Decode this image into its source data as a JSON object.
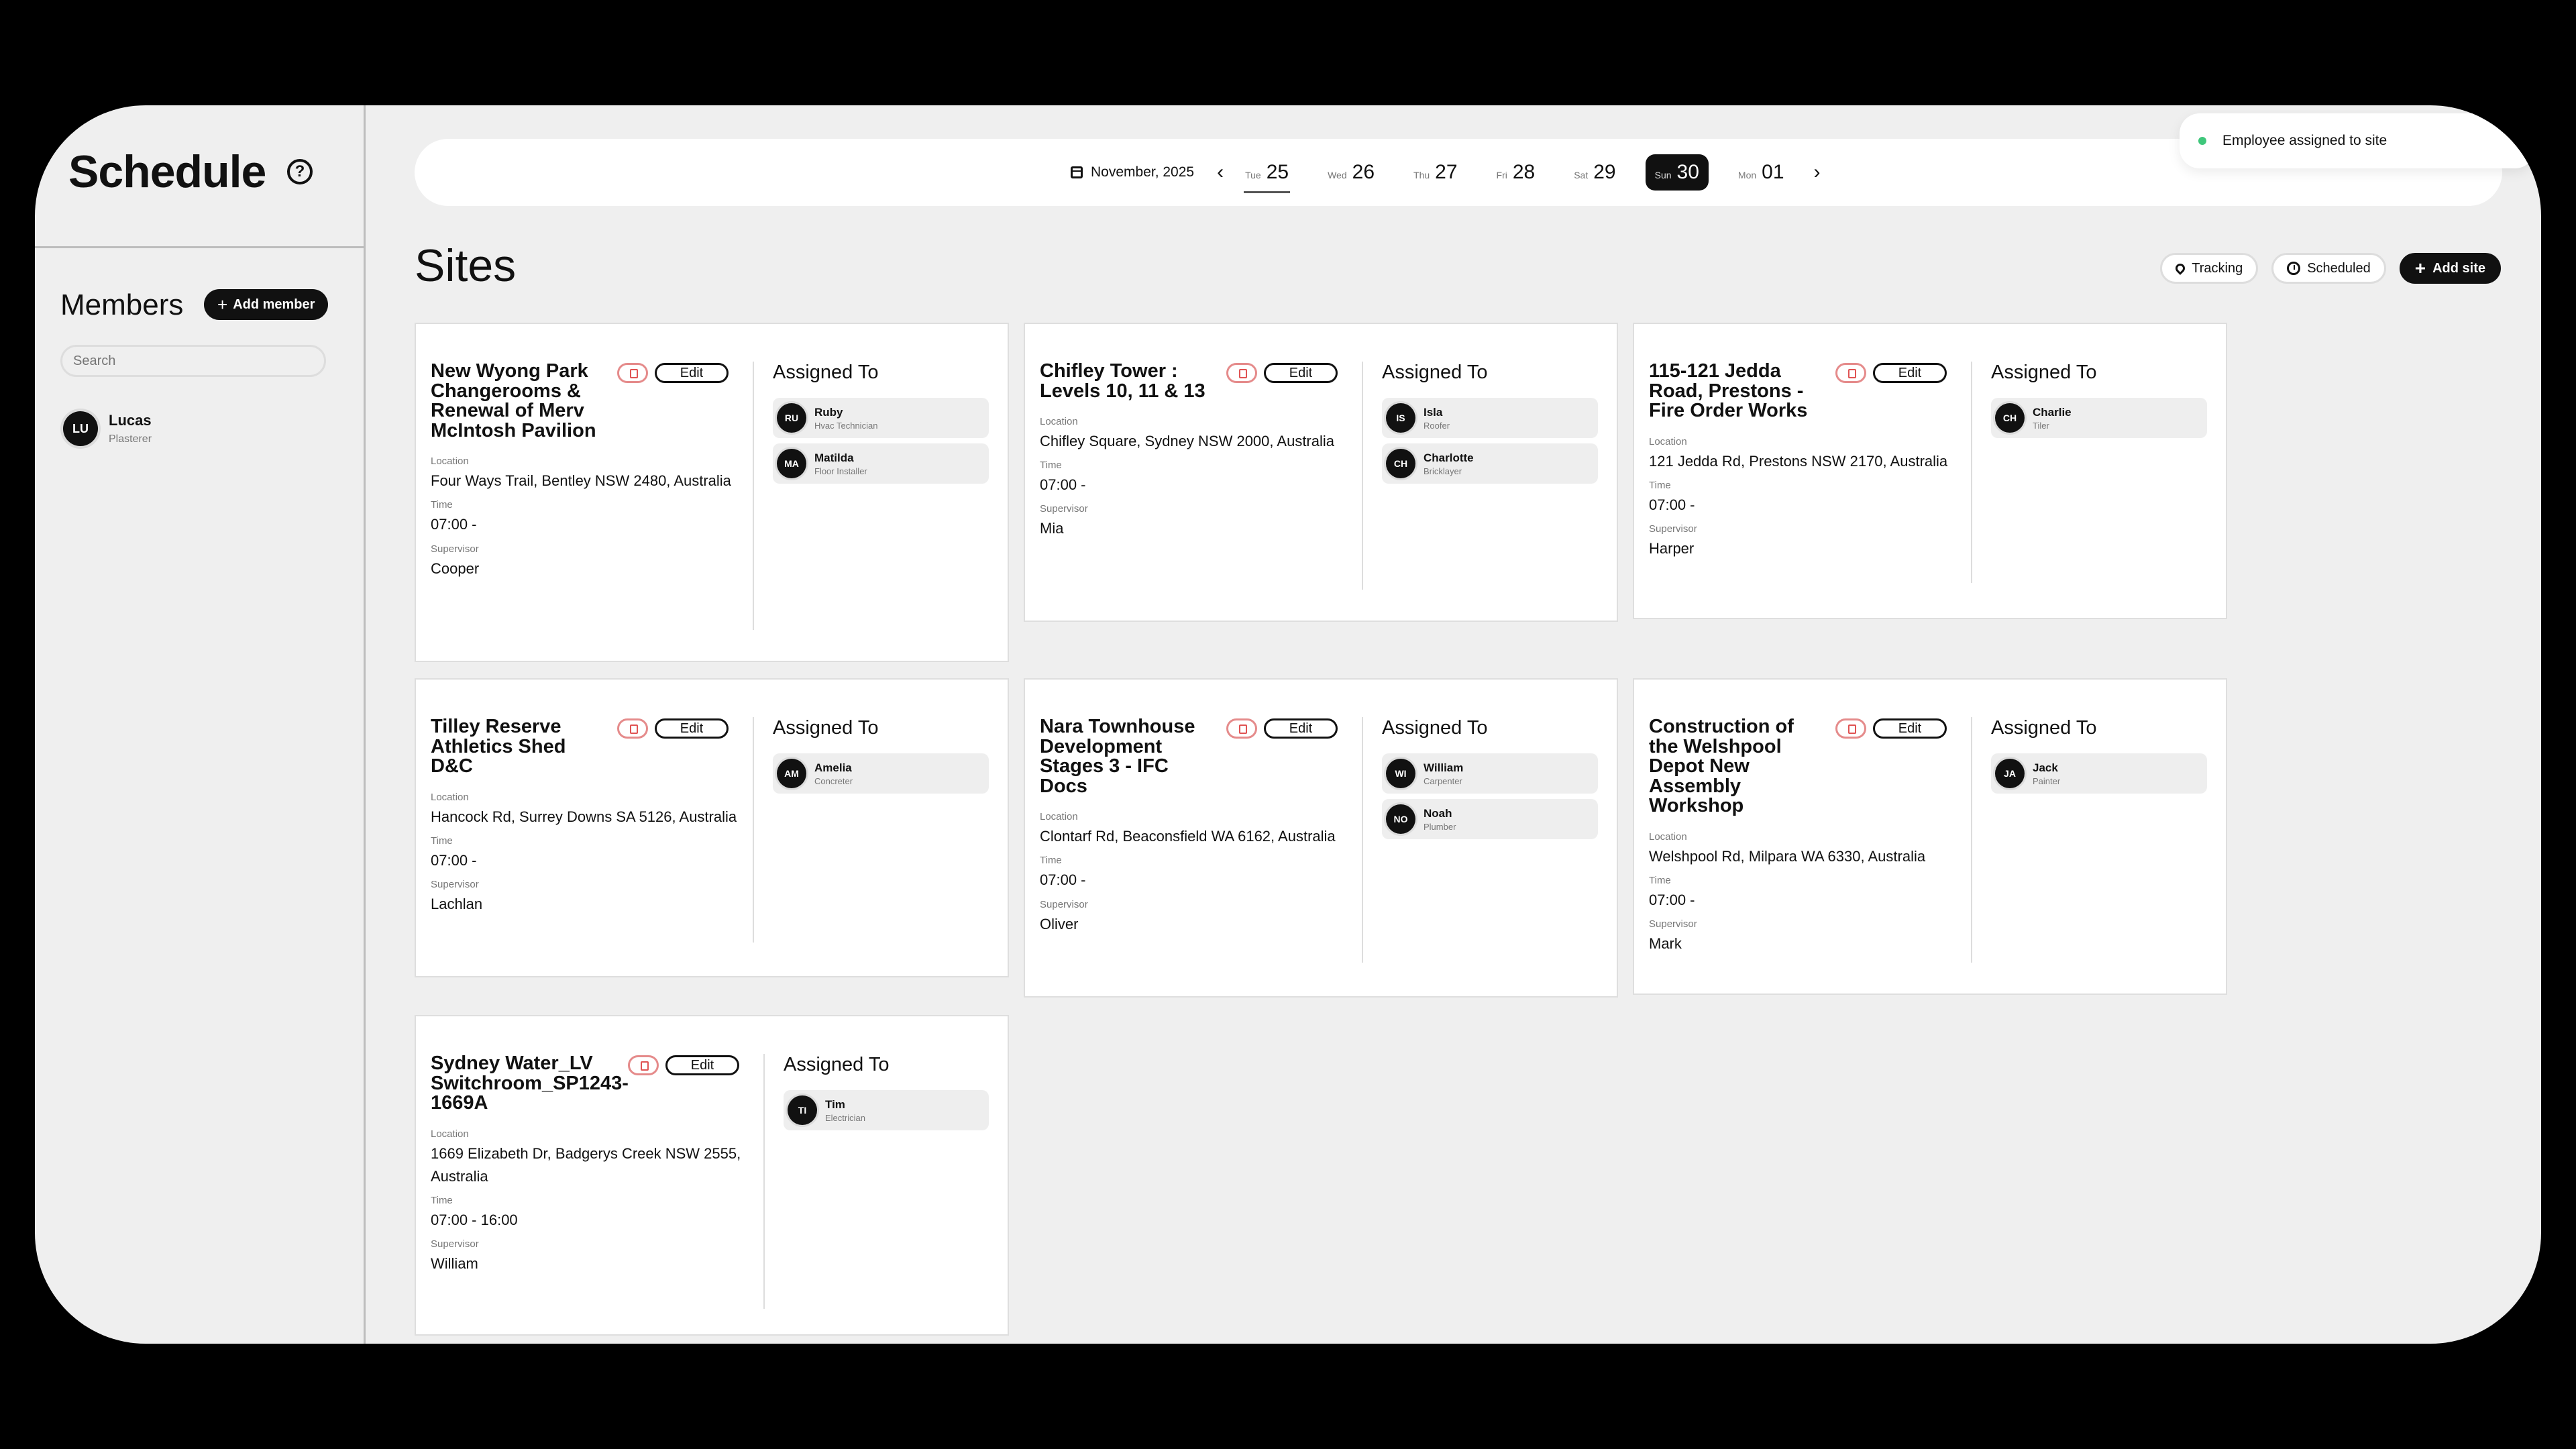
{
  "app": {
    "title": "Schedule"
  },
  "sidebar": {
    "members_title": "Members",
    "add_member_label": "Add member",
    "search_placeholder": "Search",
    "members": [
      {
        "initials": "LU",
        "name": "Lucas",
        "role": "Plasterer"
      }
    ]
  },
  "datebar": {
    "month": "November, 2025",
    "days": [
      {
        "dow": "Tue",
        "num": "25"
      },
      {
        "dow": "Wed",
        "num": "26"
      },
      {
        "dow": "Thu",
        "num": "27"
      },
      {
        "dow": "Fri",
        "num": "28"
      },
      {
        "dow": "Sat",
        "num": "29"
      },
      {
        "dow": "Sun",
        "num": "30"
      },
      {
        "dow": "Mon",
        "num": "01"
      }
    ]
  },
  "toast": {
    "message": "Employee assigned to site"
  },
  "main": {
    "title": "Sites",
    "toolbar": {
      "tracking": "Tracking",
      "scheduled": "Scheduled",
      "add_site": "Add site"
    },
    "labels": {
      "location": "Location",
      "time": "Time",
      "supervisor": "Supervisor",
      "assigned_to": "Assigned To",
      "edit": "Edit"
    },
    "sites": [
      {
        "name": "New Wyong Park Changerooms & Renewal of Merv McIntosh Pavilion",
        "location": "Four Ways Trail, Bentley NSW 2480, Australia",
        "time": "07:00 -",
        "supervisor": "Cooper",
        "assigned": [
          {
            "initials": "RU",
            "name": "Ruby",
            "role": "Hvac Technician"
          },
          {
            "initials": "MA",
            "name": "Matilda",
            "role": "Floor Installer"
          }
        ]
      },
      {
        "name": "Chifley Tower : Levels 10, 11 & 13",
        "location": "Chifley Square, Sydney NSW 2000, Australia",
        "time": "07:00 -",
        "supervisor": "Mia",
        "assigned": [
          {
            "initials": "IS",
            "name": "Isla",
            "role": "Roofer"
          },
          {
            "initials": "CH",
            "name": "Charlotte",
            "role": "Bricklayer"
          }
        ]
      },
      {
        "name": "115-121 Jedda Road, Prestons - Fire Order Works",
        "location": "121 Jedda Rd, Prestons NSW 2170, Australia",
        "time": "07:00 -",
        "supervisor": "Harper",
        "assigned": [
          {
            "initials": "CH",
            "name": "Charlie",
            "role": "Tiler"
          }
        ]
      },
      {
        "name": "Tilley Reserve Athletics Shed D&C",
        "location": "Hancock Rd, Surrey Downs SA 5126, Australia",
        "time": "07:00 -",
        "supervisor": "Lachlan",
        "assigned": [
          {
            "initials": "AM",
            "name": "Amelia",
            "role": "Concreter"
          }
        ]
      },
      {
        "name": "Nara Townhouse Development Stages 3 - IFC Docs",
        "location": "Clontarf Rd, Beaconsfield WA 6162, Australia",
        "time": "07:00 -",
        "supervisor": "Oliver",
        "assigned": [
          {
            "initials": "WI",
            "name": "William",
            "role": "Carpenter"
          },
          {
            "initials": "NO",
            "name": "Noah",
            "role": "Plumber"
          }
        ]
      },
      {
        "name": "Construction of the Welshpool Depot New Assembly Workshop",
        "location": "Welshpool Rd, Milpara WA 6330, Australia",
        "time": "07:00 -",
        "supervisor": "Mark",
        "assigned": [
          {
            "initials": "JA",
            "name": "Jack",
            "role": "Painter"
          }
        ]
      },
      {
        "name": "Sydney Water_LV Switchroom_SP1243-1669A",
        "location": "1669 Elizabeth Dr, Badgerys Creek NSW 2555, Australia",
        "time": "07:00 - 16:00",
        "supervisor": "William",
        "assigned": [
          {
            "initials": "TI",
            "name": "Tim",
            "role": "Electrician"
          }
        ]
      }
    ]
  }
}
